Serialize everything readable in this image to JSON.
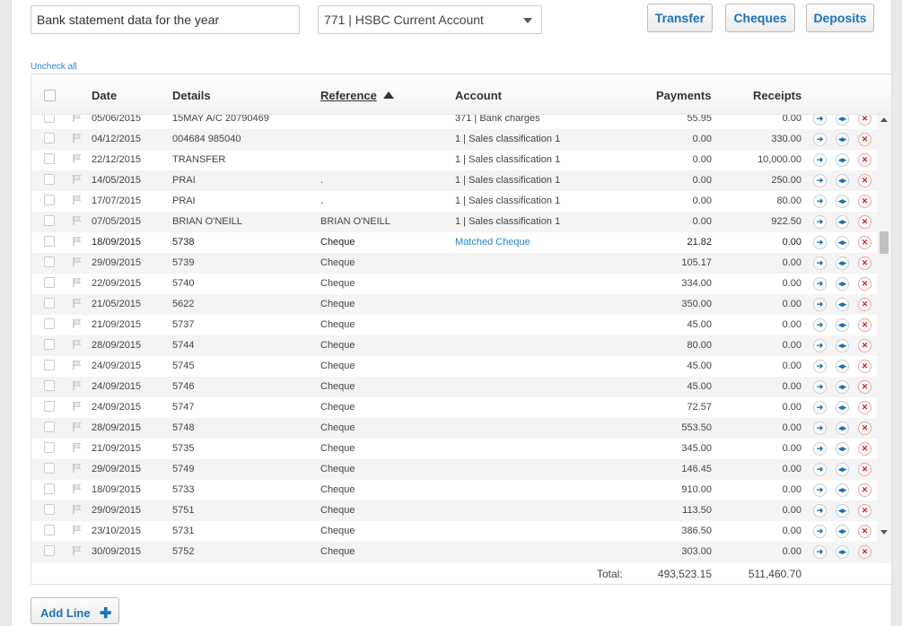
{
  "description_value": "Bank statement data for the year",
  "account_select": "771 | HSBC Current Account",
  "buttons": {
    "transfer": "Transfer",
    "cheques": "Cheques",
    "deposits": "Deposits"
  },
  "uncheck_all": "Uncheck all",
  "headers": {
    "date": "Date",
    "details": "Details",
    "reference": "Reference",
    "account": "Account",
    "payments": "Payments",
    "receipts": "Receipts"
  },
  "rows": [
    {
      "date": "05/06/2015",
      "details": "15MAY A/C 20790469",
      "reference": "",
      "account": "371 | Bank charges",
      "payments": "55.95",
      "receipts": "0.00"
    },
    {
      "date": "04/12/2015",
      "details": "004684 985040",
      "reference": "",
      "account": "1 | Sales classification 1",
      "payments": "0.00",
      "receipts": "330.00"
    },
    {
      "date": "22/12/2015",
      "details": "TRANSFER",
      "reference": "",
      "account": "1 | Sales classification 1",
      "payments": "0.00",
      "receipts": "10,000.00"
    },
    {
      "date": "14/05/2015",
      "details": "PRAI",
      "reference": ".",
      "account": "1 | Sales classification 1",
      "payments": "0.00",
      "receipts": "250.00"
    },
    {
      "date": "17/07/2015",
      "details": "PRAI",
      "reference": ".",
      "account": "1 | Sales classification 1",
      "payments": "0.00",
      "receipts": "80.00"
    },
    {
      "date": "07/05/2015",
      "details": "BRIAN O'NEILL",
      "reference": "BRIAN O'NEILL",
      "account": "1 | Sales classification 1",
      "payments": "0.00",
      "receipts": "922.50"
    },
    {
      "date": "18/09/2015",
      "details": "5738",
      "reference": "Cheque",
      "account": "Matched Cheque",
      "payments": "21.82",
      "receipts": "0.00"
    },
    {
      "date": "29/09/2015",
      "details": "5739",
      "reference": "Cheque",
      "account": "",
      "payments": "105.17",
      "receipts": "0.00"
    },
    {
      "date": "22/09/2015",
      "details": "5740",
      "reference": "Cheque",
      "account": "",
      "payments": "334.00",
      "receipts": "0.00"
    },
    {
      "date": "21/05/2015",
      "details": "5622",
      "reference": "Cheque",
      "account": "",
      "payments": "350.00",
      "receipts": "0.00"
    },
    {
      "date": "21/09/2015",
      "details": "5737",
      "reference": "Cheque",
      "account": "",
      "payments": "45.00",
      "receipts": "0.00"
    },
    {
      "date": "28/09/2015",
      "details": "5744",
      "reference": "Cheque",
      "account": "",
      "payments": "80.00",
      "receipts": "0.00"
    },
    {
      "date": "24/09/2015",
      "details": "5745",
      "reference": "Cheque",
      "account": "",
      "payments": "45.00",
      "receipts": "0.00"
    },
    {
      "date": "24/09/2015",
      "details": "5746",
      "reference": "Cheque",
      "account": "",
      "payments": "45.00",
      "receipts": "0.00"
    },
    {
      "date": "24/09/2015",
      "details": "5747",
      "reference": "Cheque",
      "account": "",
      "payments": "72.57",
      "receipts": "0.00"
    },
    {
      "date": "28/09/2015",
      "details": "5748",
      "reference": "Cheque",
      "account": "",
      "payments": "553.50",
      "receipts": "0.00"
    },
    {
      "date": "21/09/2015",
      "details": "5735",
      "reference": "Cheque",
      "account": "",
      "payments": "345.00",
      "receipts": "0.00"
    },
    {
      "date": "29/09/2015",
      "details": "5749",
      "reference": "Cheque",
      "account": "",
      "payments": "146.45",
      "receipts": "0.00"
    },
    {
      "date": "18/09/2015",
      "details": "5733",
      "reference": "Cheque",
      "account": "",
      "payments": "910.00",
      "receipts": "0.00"
    },
    {
      "date": "29/09/2015",
      "details": "5751",
      "reference": "Cheque",
      "account": "",
      "payments": "113.50",
      "receipts": "0.00"
    },
    {
      "date": "23/10/2015",
      "details": "5731",
      "reference": "Cheque",
      "account": "",
      "payments": "386.50",
      "receipts": "0.00"
    },
    {
      "date": "30/09/2015",
      "details": "5752",
      "reference": "Cheque",
      "account": "",
      "payments": "303.00",
      "receipts": "0.00"
    }
  ],
  "totals": {
    "label": "Total:",
    "payments": "493,523.15",
    "receipts": "511,460.70"
  },
  "add_line": "Add Line",
  "colors": {
    "accent": "#1a73b8",
    "link": "#2a86c7",
    "delete": "#d01f1f"
  },
  "icons": [
    "flag-icon",
    "arrow-right-icon",
    "split-icon",
    "delete-icon",
    "sort-up-icon",
    "plus-icon",
    "caret-down-icon"
  ]
}
